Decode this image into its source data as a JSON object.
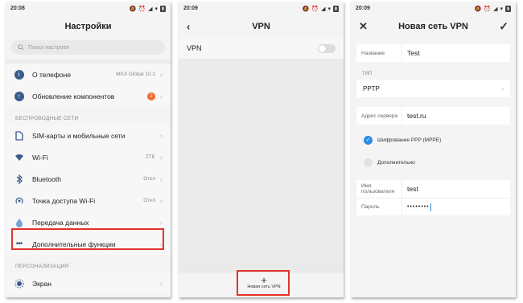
{
  "colors": {
    "highlight": "#e3322b",
    "accent": "#2a8be6",
    "badge": "#f06a2f"
  },
  "screen1": {
    "time": "20:08",
    "title": "Настройки",
    "search_placeholder": "Поиск настроек",
    "items_top": [
      {
        "label": "О телефоне",
        "value": "MIUI Global 10.2",
        "icon": "info-icon"
      },
      {
        "label": "Обновление компонентов",
        "badge": "2",
        "icon": "update-icon"
      }
    ],
    "section_wireless": "БЕСПРОВОДНЫЕ СЕТИ",
    "items_wireless": [
      {
        "label": "SIM-карты и мобильные сети",
        "value": "",
        "icon": "sim-icon"
      },
      {
        "label": "Wi-Fi",
        "value": "ZTE",
        "icon": "wifi-icon"
      },
      {
        "label": "Bluetooth",
        "value": "Откл",
        "icon": "bluetooth-icon"
      },
      {
        "label": "Точка доступа Wi-Fi",
        "value": "Откл",
        "icon": "hotspot-icon"
      },
      {
        "label": "Передача данных",
        "value": "",
        "icon": "data-usage-icon"
      },
      {
        "label": "Дополнительные функции",
        "value": "",
        "icon": "more-dots-icon"
      }
    ],
    "section_personal": "ПЕРСОНАЛИЗАЦИЯ",
    "items_personal": [
      {
        "label": "Экран",
        "value": "",
        "icon": "display-icon"
      }
    ]
  },
  "screen2": {
    "time": "20:09",
    "title": "VPN",
    "vpn_label": "VPN",
    "add_label": "Новая сеть VPN"
  },
  "screen3": {
    "time": "20:09",
    "title": "Новая сеть VPN",
    "name_label": "Название",
    "name_value": "Test",
    "type_label": "ТИП",
    "type_value": "PPTP",
    "server_label": "Адрес сервера",
    "server_value": "test.ru",
    "ppe_label": "Шифрование PPP (MPPE)",
    "advanced_label": "Дополнительно",
    "user_label": "Имя пользователя",
    "user_value": "test",
    "password_label": "Пароль",
    "password_value": "••••••••"
  }
}
